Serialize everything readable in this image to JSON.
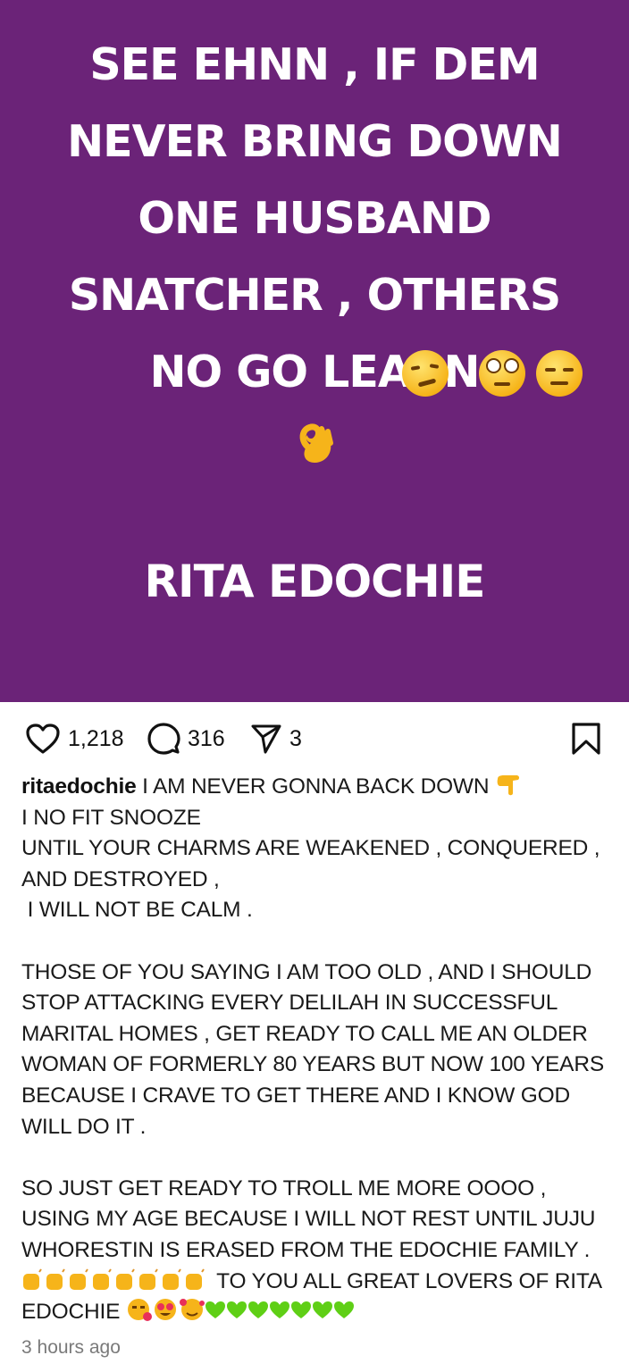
{
  "post": {
    "headline": "SEE EHNN , IF DEM\nNEVER BRING DOWN\nONE HUSBAND\nSNATCHER , OTHERS\nNO GO LEARN",
    "signature": "RITA EDOCHIE",
    "background_color": "#6b2378",
    "headline_emojis": [
      "smirking-face",
      "face-with-rolling-eyes",
      "expressionless-face",
      "ok-hand"
    ]
  },
  "actions": {
    "likes": "1,218",
    "comments": "316",
    "shares": "3",
    "icons": [
      "heart-icon",
      "comment-icon",
      "share-icon",
      "bookmark-icon"
    ]
  },
  "caption": {
    "username": "ritaedochie",
    "line1": " I AM NEVER GONNA BACK DOWN ",
    "body": "I NO FIT SNOOZE\nUNTIL YOUR CHARMS ARE WEAKENED , CONQUERED ,\nAND DESTROYED ,\n I WILL NOT BE CALM .\n\nTHOSE OF YOU SAYING I AM TOO OLD , AND I SHOULD\nSTOP ATTACKING EVERY DELILAH IN SUCCESSFUL\nMARITAL HOMES , GET READY TO CALL ME AN OLDER\nWOMAN OF FORMERLY 80 YEARS BUT NOW 100 YEARS\nBECAUSE I CRAVE TO GET THERE AND I KNOW GOD\nWILL DO IT .\n\nSO JUST GET READY TO TROLL ME MORE OOOO ,\nUSING MY AGE BECAUSE I WILL NOT REST UNTIL JUJU\nWHORESTIN IS ERASED FROM THE EDOCHIE FAMILY .",
    "line_praise": " TO YOU ALL GREAT LOVERS OF RITA",
    "line_last": "EDOCHIE ",
    "emoji_names": [
      "backhand-index-pointing-down",
      "raising-hands",
      "face-blowing-kiss",
      "heart-eyes",
      "smiling-face-with-hearts",
      "green-heart"
    ]
  },
  "timestamp": "3 hours ago"
}
